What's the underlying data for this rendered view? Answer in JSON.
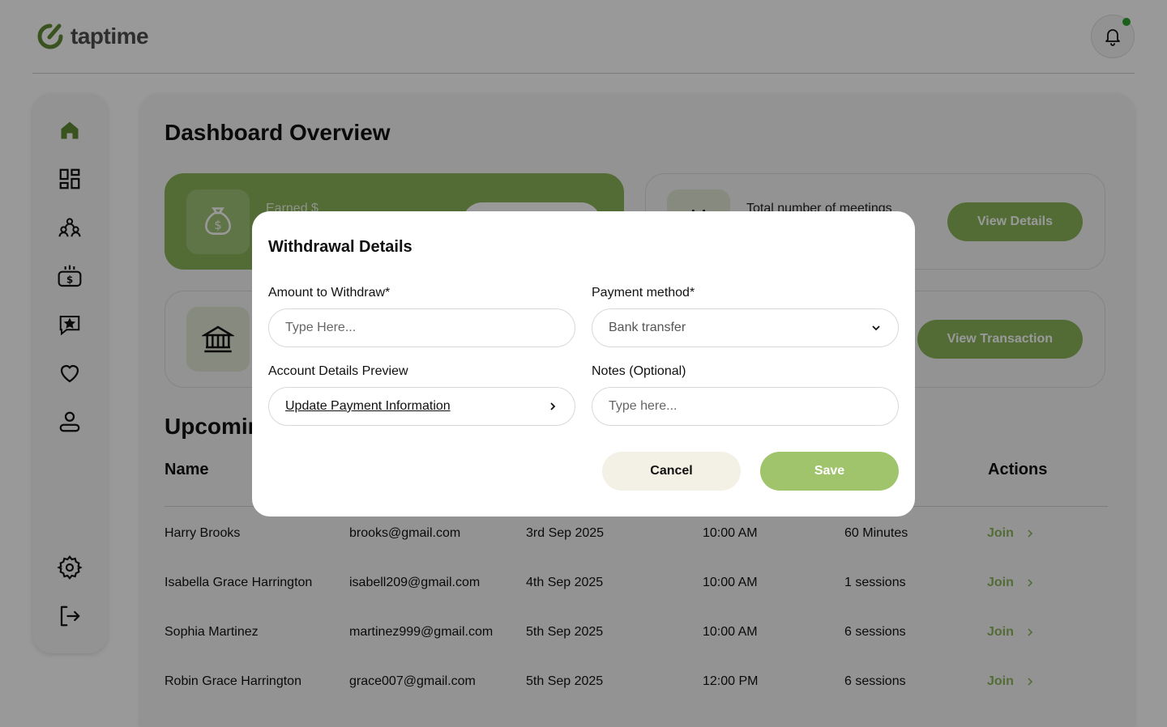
{
  "brand": {
    "name": "taptime",
    "accent": "#8ab55a",
    "notification_dot": "#2ea12e"
  },
  "header": {
    "bell_icon": "bell-icon"
  },
  "sidebar": {
    "items": [
      {
        "icon": "home-icon",
        "active": true
      },
      {
        "icon": "dashboard-grid-icon"
      },
      {
        "icon": "people-icon"
      },
      {
        "icon": "payments-icon"
      },
      {
        "icon": "review-star-icon"
      },
      {
        "icon": "heart-icon"
      },
      {
        "icon": "profile-icon"
      }
    ],
    "bottom": [
      {
        "icon": "settings-gear-icon"
      },
      {
        "icon": "logout-icon"
      }
    ]
  },
  "main": {
    "title": "Dashboard Overview",
    "cards": [
      {
        "label": "Earned $",
        "icon": "money-bag-icon"
      },
      {
        "label": "Total number of meetings",
        "icon": "calendar-icon",
        "button": "View Details"
      },
      {
        "icon": "bank-icon",
        "button": "View Transaction"
      }
    ],
    "section_title": "Upcoming",
    "table": {
      "headers": {
        "name": "Name",
        "actions": "Actions"
      },
      "rows": [
        {
          "name": "Harry Brooks",
          "email": "brooks@gmail.com",
          "date": "3rd Sep 2025",
          "time": "10:00 AM",
          "duration": "60 Minutes",
          "action": "Join"
        },
        {
          "name": "Isabella Grace Harrington",
          "email": "isabell209@gmail.com",
          "date": "4th Sep 2025",
          "time": "10:00 AM",
          "duration": "1 sessions",
          "action": "Join"
        },
        {
          "name": "Sophia Martinez",
          "email": "martinez999@gmail.com",
          "date": "5th Sep 2025",
          "time": "10:00 AM",
          "duration": "6 sessions",
          "action": "Join"
        },
        {
          "name": "Robin Grace Harrington",
          "email": "grace007@gmail.com",
          "date": "5th Sep 2025",
          "time": "12:00 PM",
          "duration": "6 sessions",
          "action": "Join"
        }
      ]
    }
  },
  "modal": {
    "title": "Withdrawal Details",
    "amount_label": "Amount to Withdraw*",
    "amount_placeholder": "Type Here...",
    "payment_label": "Payment method*",
    "payment_value": "Bank transfer",
    "account_label": "Account Details Preview",
    "account_link": "Update Payment Information",
    "notes_label": "Notes (Optional)",
    "notes_placeholder": "Type here...",
    "cancel": "Cancel",
    "save": "Save"
  }
}
